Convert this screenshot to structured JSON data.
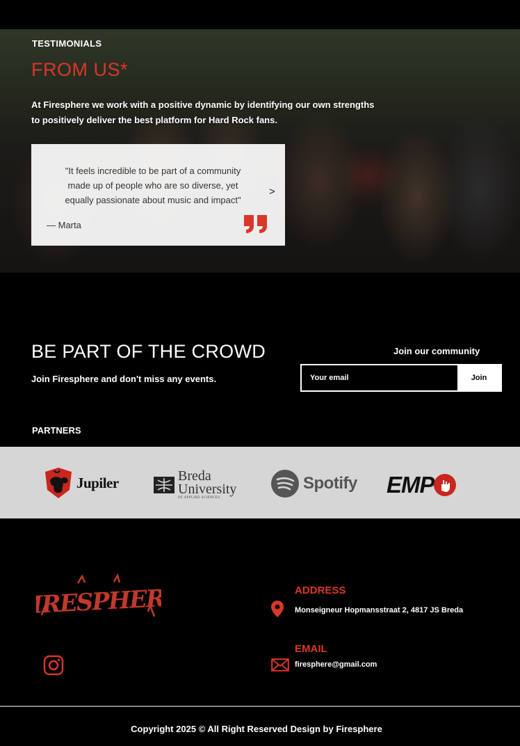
{
  "testimonials": {
    "label": "TESTIMONIALS",
    "title": "FROM US*",
    "description_line1": "At Firesphere we work with a positive dynamic by identifying our own strengths",
    "description_line2": "to positively deliver the best platform for Hard Rock fans.",
    "quote_line1": "\"It feels incredible to be part of a community",
    "quote_line2": "made up of people who are so diverse, yet",
    "quote_line3": "equally passionate about music and impact\"",
    "author": "— Marta",
    "next_label": ">"
  },
  "newsletter": {
    "title": "BE PART OF THE CROWD",
    "subtitle": "Join Firesphere and don't miss any events.",
    "join_label": "Join our community",
    "email_placeholder": "Your email",
    "join_button": "Join"
  },
  "partners": {
    "label": "PARTNERS",
    "items": {
      "jupiler": "Jupiler",
      "breda_line1": "Breda",
      "breda_line2": "University",
      "breda_tagline": "OF APPLIED SCIENCES",
      "spotify": "Spotify",
      "emp": "EMP"
    }
  },
  "footer": {
    "logo_text": "FIRESPHERE",
    "address_label": "ADDRESS",
    "address_value": "Monseigneur Hopmansstraat 2, 4817 JS Breda",
    "email_label": "EMAIL",
    "email_value": "firesphere@gmail.com",
    "copyright": "Copyright 2025 © All Right Reserved Design by Firesphere"
  },
  "colors": {
    "accent": "#d9372a",
    "background": "#000000",
    "partners_strip": "#d6d6d6"
  },
  "icons": [
    "quote-icon",
    "chevron-right-icon",
    "location-pin-icon",
    "envelope-icon",
    "instagram-icon",
    "spotify-icon",
    "bull-icon"
  ]
}
